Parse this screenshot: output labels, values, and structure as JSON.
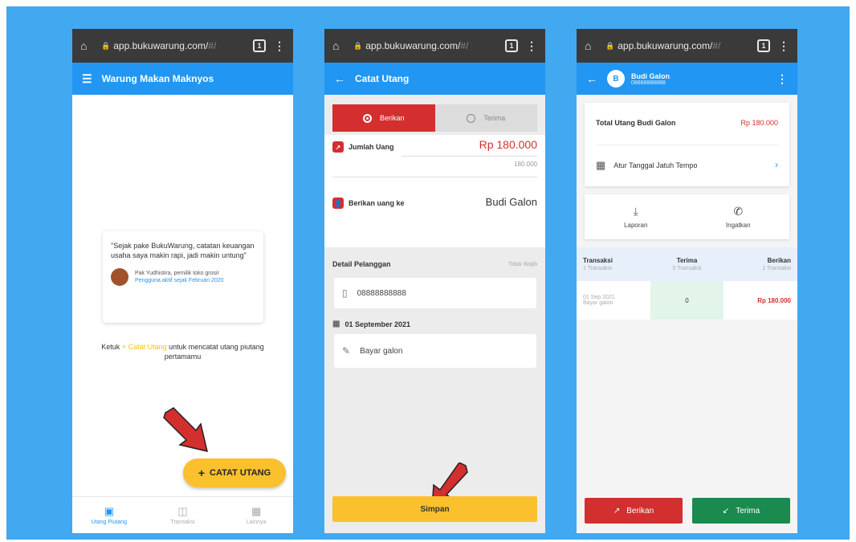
{
  "browser": {
    "url_prefix": "app.bukuwarung.com/",
    "url_suffix": "#/",
    "tab_count": "1"
  },
  "screen1": {
    "title": "Warung Makan Maknyos",
    "quote": "\"Sejak pake BukuWarung, catatan keuangan usaha saya makin rapi, jadi makin untung\"",
    "author": "Pak Yudhistira, pemilik toko grosir",
    "author_since": "Pengguna aktif sejak Februari 2020",
    "hint_before": "Ketuk",
    "hint_link": "+ Catat Utang",
    "hint_after": "untuk mencatat utang piutang pertamamu",
    "fab_label": "CATAT UTANG",
    "nav": [
      "Utang Piutang",
      "Transaksi",
      "Lainnya"
    ]
  },
  "screen2": {
    "title": "Catat Utang",
    "give_label": "Berikan",
    "receive_label": "Terima",
    "amount_label": "Jumlah Uang",
    "amount_value": "Rp 180.000",
    "amount_sub": "180.000",
    "recipient_label": "Berikan uang ke",
    "recipient_value": "Budi Galon",
    "detail_label": "Detail Pelanggan",
    "detail_optional": "Tidak Wajib",
    "phone": "08888888888",
    "date": "01 September 2021",
    "note": "Bayar galon",
    "save_label": "Simpan"
  },
  "screen3": {
    "contact_initial": "B",
    "contact_name": "Budi Galon",
    "contact_phone": "08888888888",
    "total_label": "Total Utang Budi Galon",
    "total_value": "Rp 180.000",
    "due_label": "Atur Tanggal Jatuh Tempo",
    "report_label": "Laporan",
    "remind_label": "Ingatkan",
    "col_transaksi": "Transaksi",
    "col_transaksi_sub": "1 Transaksi",
    "col_terima": "Terima",
    "col_terima_sub": "0 Transaksi",
    "col_berikan": "Berikan",
    "col_berikan_sub": "1 Transaksi",
    "row_date": "01 Sep 2021",
    "row_note": "Bayar galon",
    "row_terima": "0",
    "row_berikan": "Rp 180.000",
    "btn_give": "Berikan",
    "btn_receive": "Terima"
  },
  "colors": {
    "primary": "#2196f3",
    "accent": "#fbc02d",
    "give": "#d32f2f",
    "receive": "#1b8a4e",
    "background": "#42a8f0"
  },
  "icons": [
    "home-icon",
    "lock-icon",
    "menu-icon",
    "back-arrow-icon",
    "plus-icon",
    "phone-icon",
    "calendar-icon",
    "pencil-icon",
    "download-icon",
    "whatsapp-icon",
    "chevron-right-icon",
    "red-pointer-arrow"
  ]
}
